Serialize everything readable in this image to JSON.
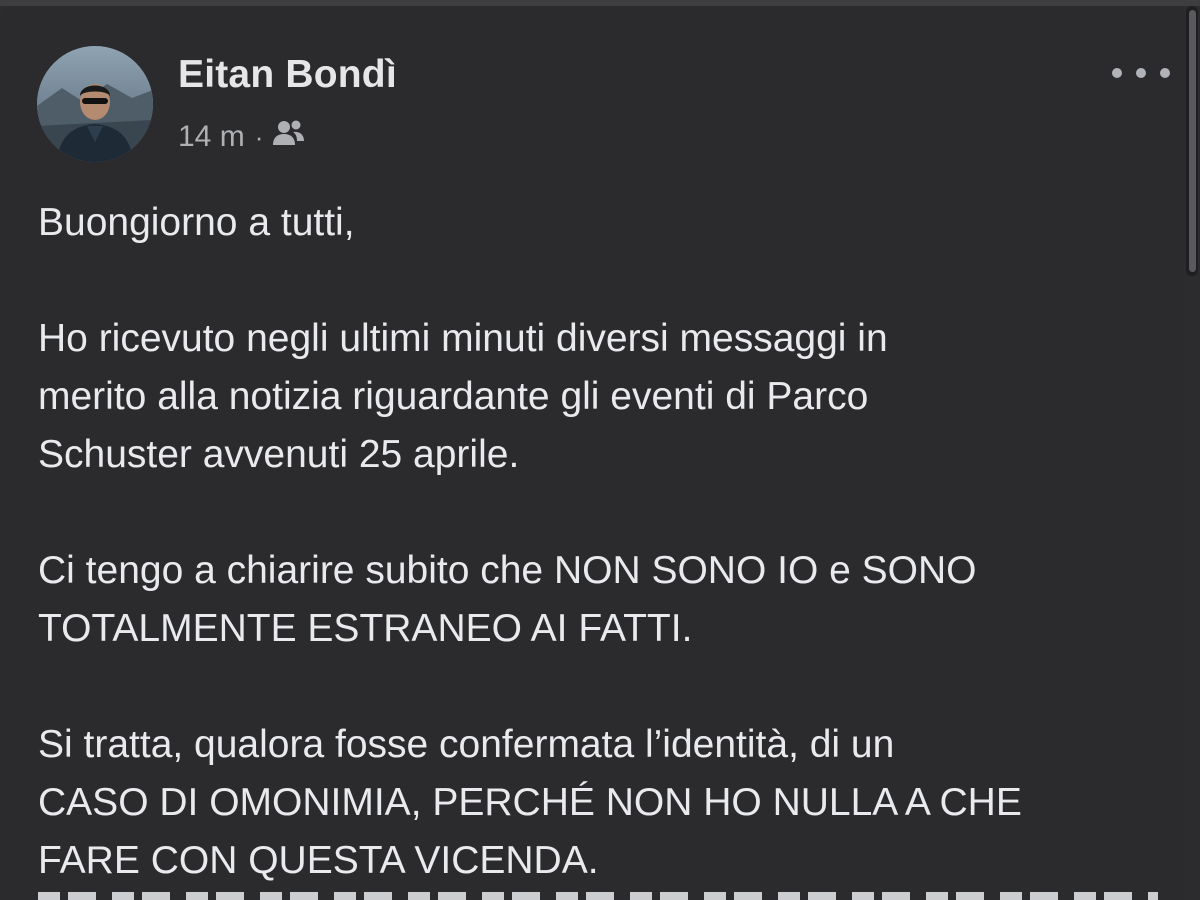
{
  "post": {
    "author": "Eitan Bondì",
    "time": "14 m",
    "separator": "·",
    "privacy_icon": "friends-icon",
    "more_icon": "more-dots-icon",
    "paragraphs": [
      "Buongiorno a tutti,",
      "Ho ricevuto negli ultimi minuti diversi messaggi in merito alla notizia riguardante gli eventi di Parco Schuster avvenuti 25 aprile.",
      "Ci tengo a chiarire subito che NON SONO IO e SONO TOTALMENTE ESTRANEO AI FATTI.",
      "Si tratta, qualora fosse confermata l’identità, di un CASO DI OMONIMIA, PERCHÉ NON HO NULLA A CHE FARE CON QUESTA VICENDA."
    ],
    "lines": [
      [
        "Buongiorno a tutti,"
      ],
      [
        "Ho ricevuto negli ultimi minuti diversi messaggi in",
        "merito alla notizia riguardante gli eventi di Parco",
        "Schuster avvenuti 25 aprile."
      ],
      [
        "Ci tengo a chiarire subito che NON SONO IO e SONO",
        "TOTALMENTE ESTRANEO AI FATTI."
      ],
      [
        "Si tratta, qualora fosse confermata l’identità, di un",
        "CASO DI OMONIMIA, PERCHÉ NON HO NULLA A CHE",
        "FARE CON QUESTA VICENDA."
      ]
    ]
  },
  "colors": {
    "background": "#2b2b2d",
    "text": "#e9eaed",
    "meta_text": "#aeb0b4"
  }
}
